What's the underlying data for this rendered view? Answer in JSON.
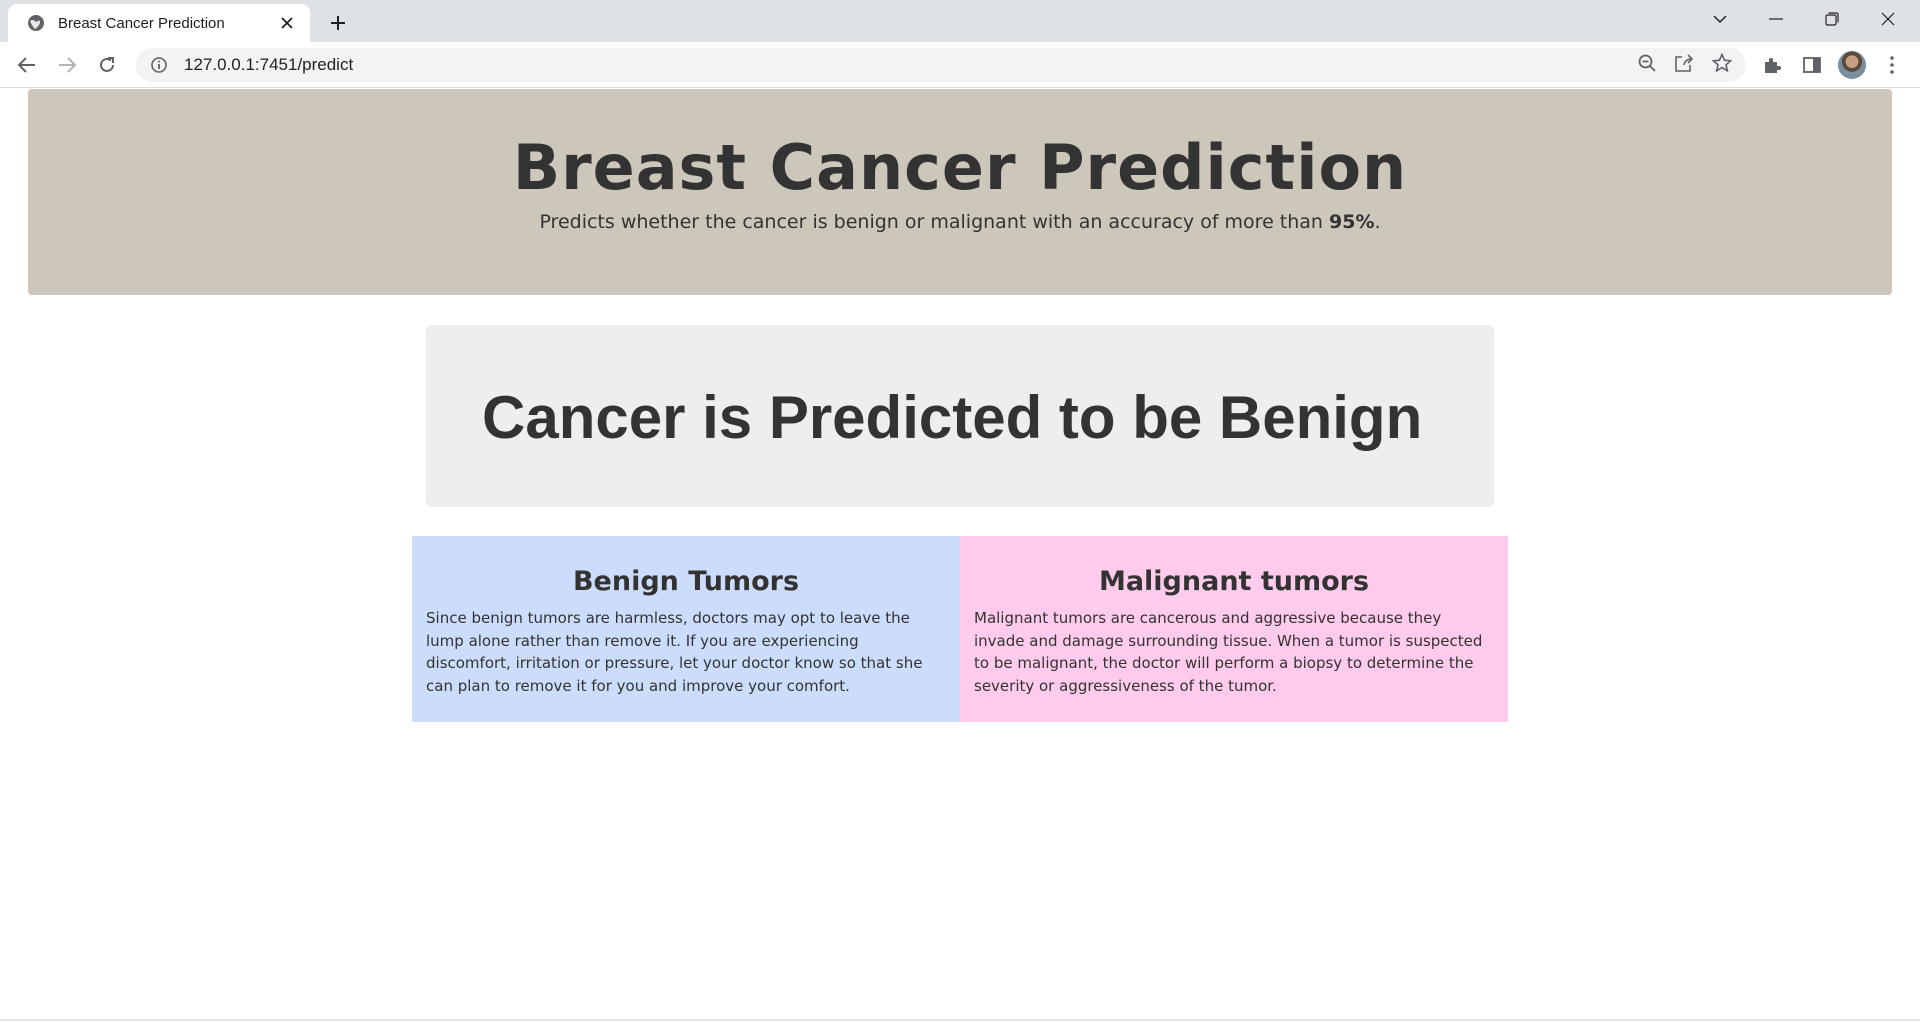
{
  "browser": {
    "tab_title": "Breast Cancer Prediction",
    "url": "127.0.0.1:7451/predict",
    "icons": {
      "favicon": "globe-icon",
      "close": "close-icon",
      "new_tab": "plus-icon",
      "back": "arrow-left-icon",
      "forward": "arrow-right-icon",
      "reload": "reload-icon",
      "info": "info-icon",
      "zoom": "zoom-out-icon",
      "share": "share-icon",
      "bookmark": "star-icon",
      "extensions": "puzzle-icon",
      "side_panel": "side-panel-icon",
      "menu": "more-vert-icon"
    }
  },
  "header": {
    "title": "Breast Cancer Prediction",
    "subtitle_before": "Predicts whether the cancer is benign or malignant with an accuracy of more than ",
    "subtitle_bold": "95%",
    "subtitle_after": "."
  },
  "result": {
    "text": "Cancer is Predicted to be Benign"
  },
  "info": {
    "benign": {
      "title": "Benign Tumors",
      "text": "Since benign tumors are harmless, doctors may opt to leave the lump alone rather than remove it. If you are experiencing discomfort, irritation or pressure, let your doctor know so that she can plan to remove it for you and improve your comfort."
    },
    "malignant": {
      "title": "Malignant tumors",
      "text": "Malignant tumors are cancerous and aggressive because they invade and damage surrounding tissue. When a tumor is suspected to be malignant, the doctor will perform a biopsy to determine the severity or aggressiveness of the tumor."
    }
  },
  "colors": {
    "header_bg": "#cdc6bb",
    "result_bg": "#eeeeee",
    "benign_bg": "#ccdcfb",
    "malignant_bg": "#fecbec",
    "text": "#333333"
  }
}
